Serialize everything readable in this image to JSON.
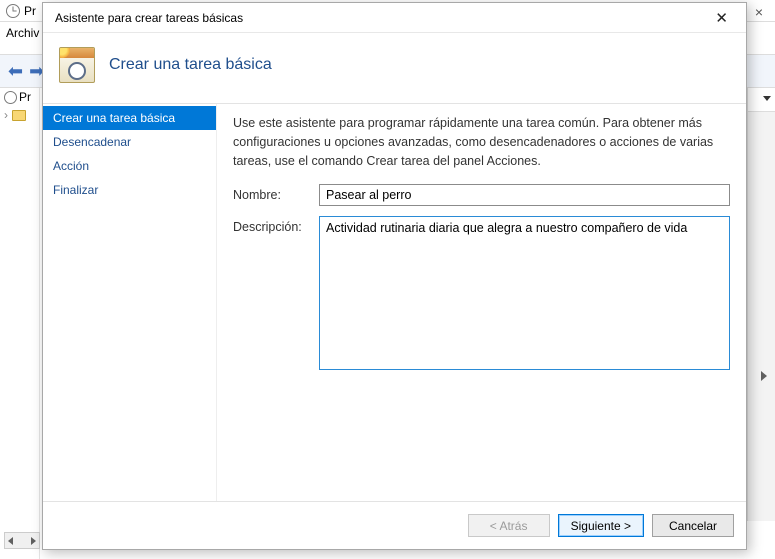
{
  "background": {
    "title_fragment": "Pr",
    "menu_fragment": "Archiv",
    "tree_label_fragment": "Pr"
  },
  "wizard": {
    "window_title": "Asistente para crear tareas básicas",
    "heading": "Crear una tarea básica",
    "steps": [
      {
        "label": "Crear una tarea básica",
        "active": true
      },
      {
        "label": "Desencadenar",
        "active": false
      },
      {
        "label": "Acción",
        "active": false
      },
      {
        "label": "Finalizar",
        "active": false
      }
    ],
    "intro": "Use este asistente para programar rápidamente una tarea común. Para obtener más configuraciones u opciones avanzadas, como desencadenadores o acciones de varias tareas, use el comando Crear tarea del panel Acciones.",
    "fields": {
      "name_label": "Nombre:",
      "name_value": "Pasear al perro",
      "desc_label": "Descripción:",
      "desc_value": "Actividad rutinaria diaria que alegra a nuestro compañero de vida"
    },
    "buttons": {
      "back": "< Atrás",
      "next": "Siguiente >",
      "cancel": "Cancelar"
    }
  }
}
